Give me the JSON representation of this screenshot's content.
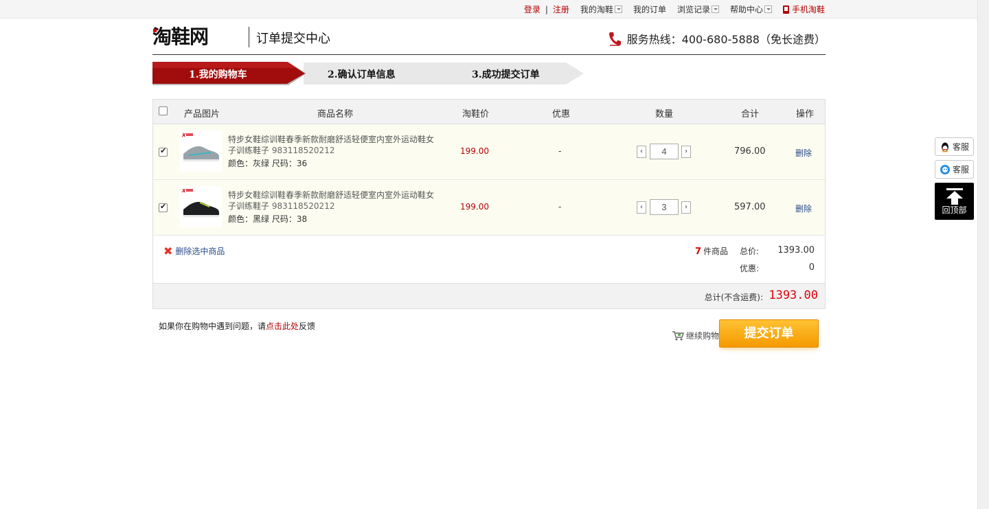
{
  "topbar": {
    "login": "登录",
    "separator": "|",
    "register": "注册",
    "my_taoxie": "我的淘鞋",
    "my_orders": "我的订单",
    "history": "浏览记录",
    "help": "帮助中心",
    "mobile": "手机淘鞋"
  },
  "header": {
    "logo_text": "淘鞋网",
    "title": "订单提交中心",
    "hotline": "服务热线：400-680-5888（免长途费）"
  },
  "steps": [
    {
      "label": "1.我的购物车",
      "active": true
    },
    {
      "label": "2.确认订单信息",
      "active": false
    },
    {
      "label": "3.成功提交订单",
      "active": false
    }
  ],
  "table": {
    "headers": {
      "image": "产品图片",
      "name": "商品名称",
      "price": "淘鞋价",
      "discount": "优惠",
      "quantity": "数量",
      "subtotal": "合计",
      "action": "操作"
    }
  },
  "items": [
    {
      "name": "特步女鞋综训鞋春季新款耐磨舒适轻便室内室外运动鞋女子训练鞋子",
      "code": "983118520212",
      "attrs": "颜色：灰绿 尺码：36",
      "price": "199.00",
      "discount": "-",
      "quantity": "4",
      "subtotal": "796.00",
      "delete": "删除",
      "checked": true,
      "shoe_color": "#9aa3aa"
    },
    {
      "name": "特步女鞋综训鞋春季新款耐磨舒适轻便室内室外运动鞋女子训练鞋子",
      "code": "983118520212",
      "attrs": "颜色：黑绿 尺码：38",
      "price": "199.00",
      "discount": "-",
      "quantity": "3",
      "subtotal": "597.00",
      "delete": "删除",
      "checked": true,
      "shoe_color": "#1d1f21"
    }
  ],
  "summary": {
    "delete_selected": "删除选中商品",
    "count": "7",
    "count_suffix": "件商品",
    "total_label": "总价:",
    "total_value": "1393.00",
    "discount_label": "优惠:",
    "discount_value": "0",
    "grand_label": "总计(不含运费):",
    "grand_value": "1393.00"
  },
  "footer": {
    "feedback_prefix": "如果你在购物中遇到问题，请",
    "feedback_link": "点击此处",
    "feedback_suffix": "反馈",
    "continue": "继续购物",
    "submit": "提交订单"
  },
  "float": {
    "service1": "客服",
    "service2": "客服",
    "top": "回顶部"
  },
  "colors": {
    "brand_red": "#b50000",
    "price_red": "#e2000b",
    "submit_orange": "#f7a81b"
  }
}
